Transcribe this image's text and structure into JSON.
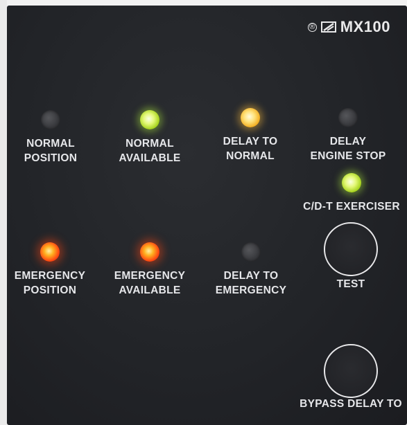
{
  "logo": {
    "reg_symbol": "®",
    "model": "MX100"
  },
  "indicators": [
    {
      "id": "normal-position",
      "lines": [
        "NORMAL",
        "POSITION"
      ],
      "state": "off",
      "color": "#3a3b3f"
    },
    {
      "id": "normal-available",
      "lines": [
        "NORMAL",
        "AVAILABLE"
      ],
      "state": "on",
      "color": "#c9ef3a"
    },
    {
      "id": "delay-to-normal",
      "lines": [
        "DELAY TO",
        "NORMAL"
      ],
      "state": "on",
      "color": "#f7c447"
    },
    {
      "id": "delay-engine-stop",
      "lines": [
        "DELAY",
        "ENGINE STOP"
      ],
      "state": "off",
      "color": "#3a3b3f"
    },
    {
      "id": "cdt-exerciser",
      "lines": [
        "C/D-T EXERCISER"
      ],
      "state": "on",
      "color": "#c9ef3a"
    },
    {
      "id": "emergency-position",
      "lines": [
        "EMERGENCY",
        "POSITION"
      ],
      "state": "on",
      "color": "#ff5a14"
    },
    {
      "id": "emergency-available",
      "lines": [
        "EMERGENCY",
        "AVAILABLE"
      ],
      "state": "on",
      "color": "#ff5a14"
    },
    {
      "id": "delay-to-emergency",
      "lines": [
        "DELAY TO",
        "EMERGENCY"
      ],
      "state": "off",
      "color": "#3a3b3f"
    }
  ],
  "buttons": {
    "test": "TEST",
    "bypass": "BYPASS DELAY TO"
  }
}
